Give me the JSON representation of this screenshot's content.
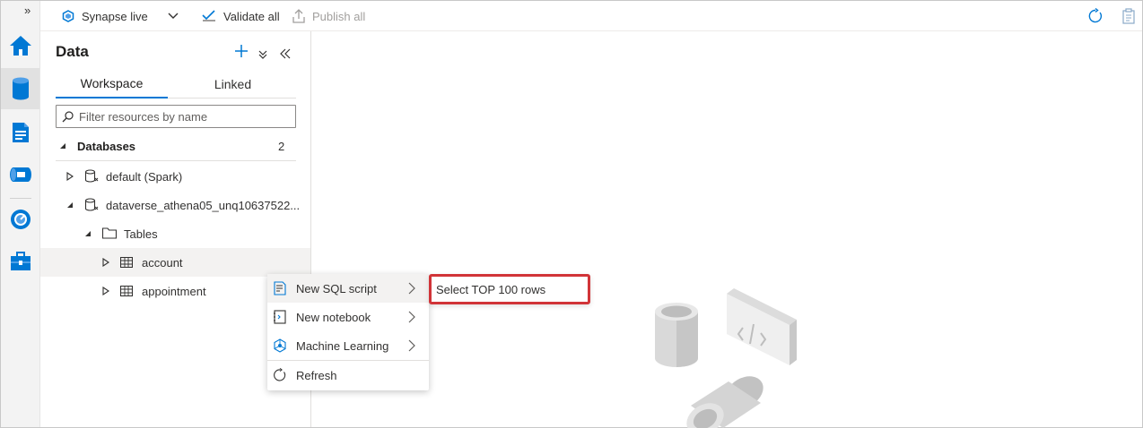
{
  "toolbar": {
    "mode_label": "Synapse live",
    "validate_label": "Validate all",
    "publish_label": "Publish all"
  },
  "rail": {
    "expand_glyph": "»",
    "items": [
      "home-icon",
      "data-icon",
      "develop-icon",
      "integrate-icon",
      "monitor-icon",
      "manage-icon"
    ]
  },
  "panel": {
    "title": "Data",
    "tabs": [
      {
        "label": "Workspace",
        "active": true
      },
      {
        "label": "Linked",
        "active": false
      }
    ],
    "filter_placeholder": "Filter resources by name",
    "databases": {
      "label": "Databases",
      "count": "2",
      "items": [
        {
          "label": "default (Spark)",
          "expanded": false
        },
        {
          "label": "dataverse_athena05_unq10637522...",
          "expanded": true,
          "folder": "Tables",
          "tables": [
            "account",
            "appointment"
          ]
        }
      ]
    }
  },
  "context_menu": {
    "items": [
      {
        "label": "New SQL script",
        "has_submenu": true
      },
      {
        "label": "New notebook",
        "has_submenu": true
      },
      {
        "label": "Machine Learning",
        "has_submenu": true
      },
      {
        "label": "Refresh",
        "has_submenu": false
      }
    ]
  },
  "submenu": {
    "items": [
      "Select TOP 100 rows"
    ]
  },
  "colors": {
    "accent": "#0078d4",
    "highlight": "#d13438"
  }
}
